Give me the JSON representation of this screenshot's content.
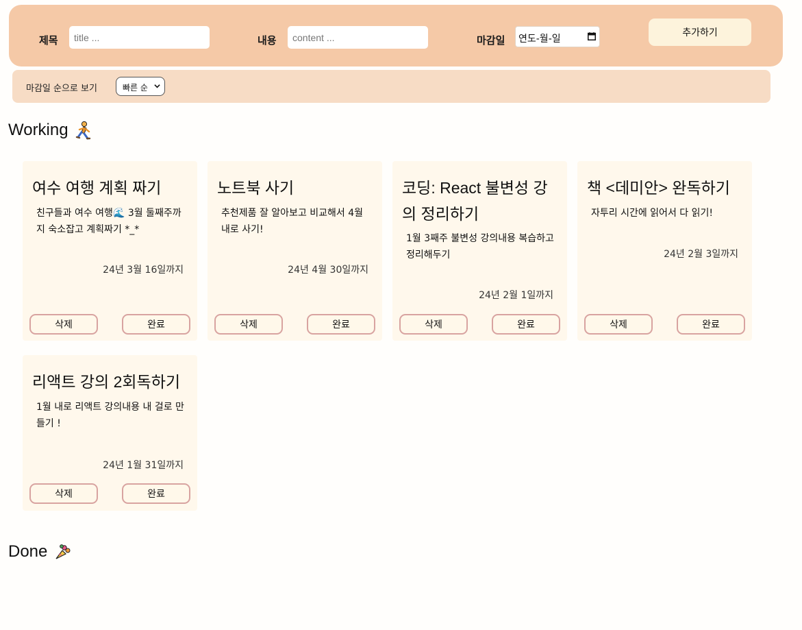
{
  "form": {
    "title_label": "제목",
    "title_placeholder": "title ...",
    "content_label": "내용",
    "content_placeholder": "content ...",
    "deadline_label": "마감일",
    "date_value": "연도-월-일",
    "add_button": "추가하기"
  },
  "sort": {
    "label": "마감일 순으로 보기",
    "selected": "빠른 순"
  },
  "working": {
    "title": "Working",
    "icon": "runner-icon"
  },
  "done": {
    "title": "Done",
    "icon": "bouquet-icon"
  },
  "cards": [
    {
      "title": "여수 여행 계획 짜기",
      "body": "친구들과 여수 여행🌊 3월 둘째주까지 숙소잡고 계획짜기 *_*",
      "deadline": "24년 3월 16일까지",
      "delete_label": "삭제",
      "complete_label": "완료"
    },
    {
      "title": "노트북 사기",
      "body": "추천제품 잘 알아보고 비교해서 4월 내로 사기!",
      "deadline": "24년 4월 30일까지",
      "delete_label": "삭제",
      "complete_label": "완료"
    },
    {
      "title": "코딩: React 불변성 강의 정리하기",
      "body": "1월 3째주 불변성 강의내용 복습하고 정리해두기",
      "deadline": "24년 2월 1일까지",
      "delete_label": "삭제",
      "complete_label": "완료"
    },
    {
      "title": "책 <데미안> 완독하기",
      "body": "자투리 시간에 읽어서 다 읽기!",
      "deadline": "24년 2월 3일까지",
      "delete_label": "삭제",
      "complete_label": "완료"
    },
    {
      "title": "리액트 강의 2회독하기",
      "body": "1월 내로 리액트 강의내용 내 걸로 만들기 !",
      "deadline": "24년 1월 31일까지",
      "delete_label": "삭제",
      "complete_label": "완료"
    }
  ]
}
